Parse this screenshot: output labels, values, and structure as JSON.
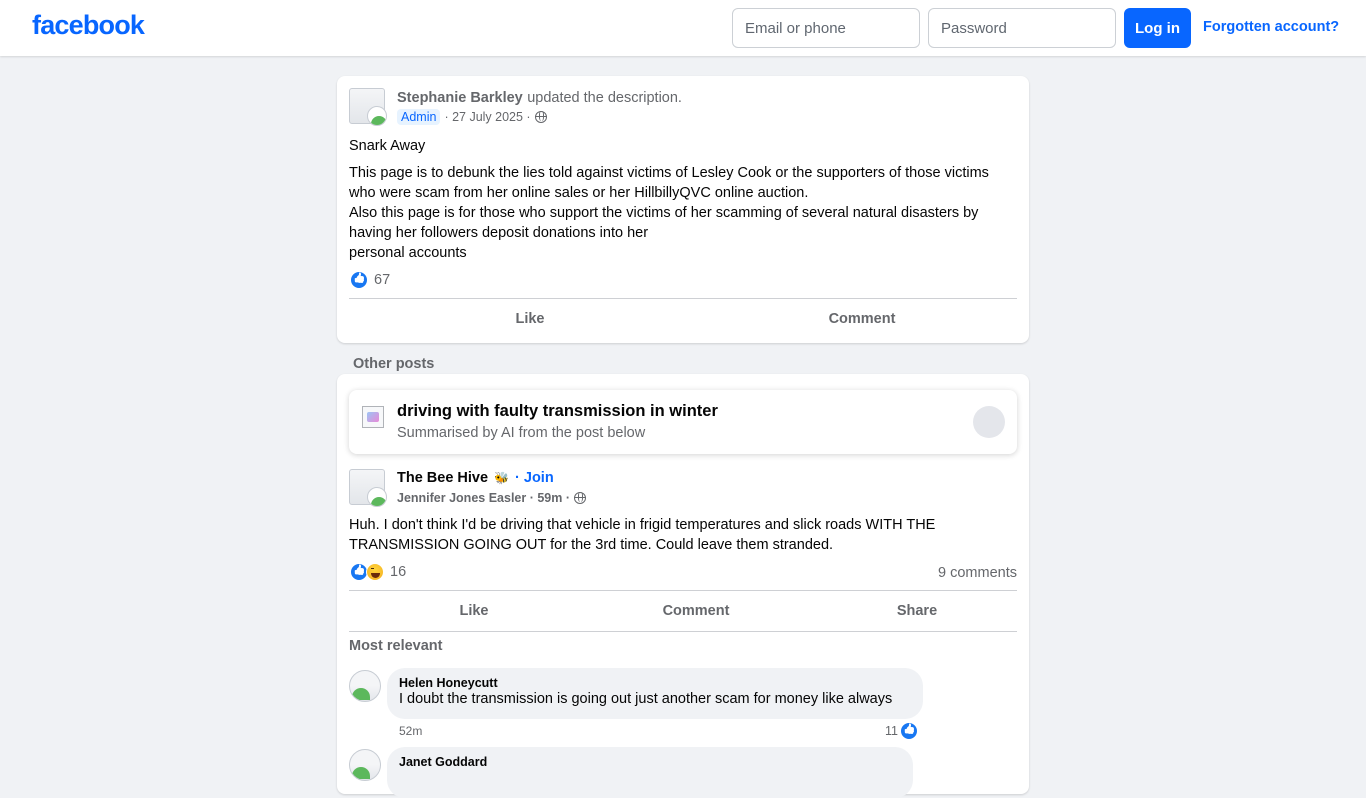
{
  "header": {
    "logo": "facebook",
    "email_placeholder": "Email or phone",
    "password_placeholder": "Password",
    "login_label": "Log in",
    "forgot_label": "Forgotten account?"
  },
  "pinned_post": {
    "author": "Stephanie Barkley",
    "action": "updated the description.",
    "role": "Admin",
    "date": "· 27 July 2025 ·",
    "title": "Snark Away",
    "body_lines": [
      "This page is to debunk the lies told against victims of Lesley Cook  or the supporters of those victims",
      "who were scam from her online sales or her HillbillyQVC online auction.",
      "Also this page is for those who support the victims of her scamming of several natural disasters by",
      "having her followers deposit donations into her",
      "personal accounts"
    ],
    "reaction_count": "67",
    "actions": {
      "like": "Like",
      "comment": "Comment"
    }
  },
  "other_posts": {
    "section_title": "Other posts",
    "ai_summary": {
      "title": "driving with faulty transmission in winter",
      "subtitle": "Summarised by AI from the post below"
    },
    "post": {
      "group": "The Bee Hive",
      "join_label": "· Join",
      "author_meta": "Jennifer Jones Easler · 59m ·",
      "body_lines": [
        "Huh. I don't think I'd be driving that vehicle in frigid temperatures and slick roads WITH THE",
        "TRANSMISSION GOING OUT for the 3rd time. Could leave them stranded."
      ],
      "reaction_count": "16",
      "comments_count": "9 comments",
      "actions": {
        "like": "Like",
        "comment": "Comment",
        "share": "Share"
      }
    },
    "comments_header": "Most relevant",
    "comments": [
      {
        "author": "Helen Honeycutt",
        "text": "I doubt the transmission is going out just another scam for money like always",
        "time": "52m",
        "likes": "11"
      },
      {
        "author": "Janet Goddard",
        "text": "",
        "time": "",
        "likes": ""
      }
    ]
  }
}
